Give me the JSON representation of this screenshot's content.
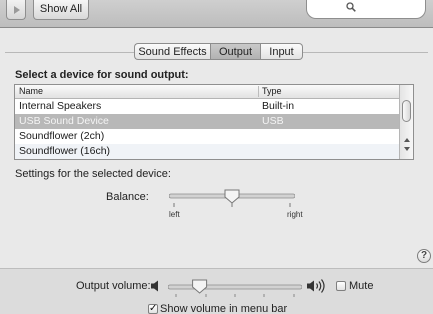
{
  "toolbar": {
    "show_all_label": "Show All",
    "search_icon": "magnifying-glass-icon",
    "nav_icon": "forward-arrow-icon"
  },
  "tabs": [
    {
      "label": "Sound Effects",
      "selected": false
    },
    {
      "label": "Output",
      "selected": true
    },
    {
      "label": "Input",
      "selected": false
    }
  ],
  "output": {
    "select_label": "Select a device for sound output:",
    "columns": [
      "Name",
      "Type"
    ],
    "devices": [
      {
        "name": "Internal Speakers",
        "type": "Built-in",
        "selected": false
      },
      {
        "name": "USB Sound Device",
        "type": "USB",
        "selected": true
      },
      {
        "name": "Soundflower (2ch)",
        "type": "",
        "selected": false
      },
      {
        "name": "Soundflower (16ch)",
        "type": "",
        "selected": false
      }
    ],
    "settings_label": "Settings for the selected device:",
    "balance": {
      "label": "Balance:",
      "left_label": "left",
      "right_label": "right",
      "value": 0.5
    }
  },
  "help_label": "?",
  "volume": {
    "label": "Output volume:",
    "value": 0.2,
    "mute_label": "Mute",
    "mute_checked": false,
    "low_icon": "speaker-low-icon",
    "high_icon": "speaker-high-icon",
    "show_in_menubar_label": "Show volume in menu bar",
    "show_in_menubar_checked": true
  },
  "colors": {
    "selected_row": "#b8b8b8",
    "selected_tab": "#b8b8b8"
  }
}
